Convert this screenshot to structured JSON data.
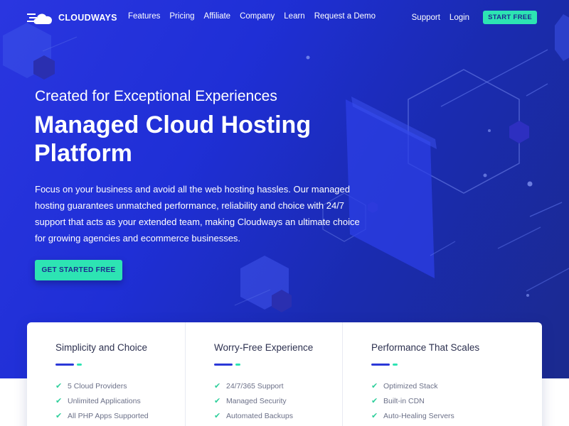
{
  "brand": {
    "name": "CLOUDWAYS"
  },
  "nav": {
    "links": [
      "Features",
      "Pricing",
      "Affiliate",
      "Company",
      "Learn",
      "Request a Demo"
    ],
    "support": "Support",
    "login": "Login",
    "start": "START FREE"
  },
  "hero": {
    "kicker": "Created for Exceptional Experiences",
    "headline": "Managed Cloud Hosting Platform",
    "description": "Focus on your business and avoid all the web hosting hassles. Our managed hosting guarantees unmatched performance, reliability and choice with 24/7 support that acts as your extended team, making Cloudways an ultimate choice for growing agencies and ecommerce businesses.",
    "cta": "GET STARTED FREE"
  },
  "features": [
    {
      "title": "Simplicity and Choice",
      "items": [
        "5 Cloud Providers",
        "Unlimited Applications",
        "All PHP Apps Supported"
      ]
    },
    {
      "title": "Worry-Free Experience",
      "items": [
        "24/7/365 Support",
        "Managed Security",
        "Automated Backups"
      ]
    },
    {
      "title": "Performance That Scales",
      "items": [
        "Optimized Stack",
        "Built-in CDN",
        "Auto-Healing Servers"
      ]
    }
  ],
  "colors": {
    "accent": "#2de4b3",
    "primary": "#2b38d8",
    "heroDark": "#1b2a8e"
  },
  "icons": {
    "logo": "cloud-logo-icon",
    "check": "check-icon"
  }
}
